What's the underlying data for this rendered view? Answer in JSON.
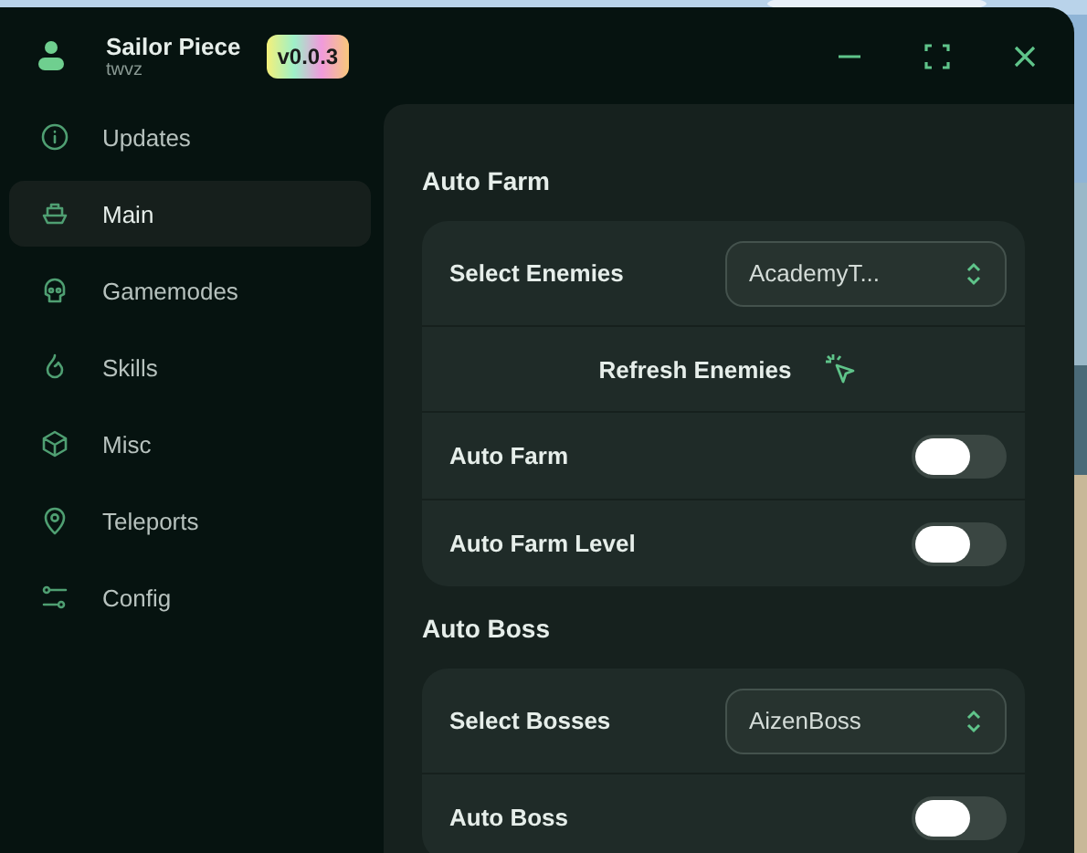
{
  "app": {
    "title": "Sailor Piece",
    "user": "twvz",
    "version": "v0.0.3"
  },
  "sidebar": {
    "items": [
      {
        "label": "Updates",
        "selected": false
      },
      {
        "label": "Main",
        "selected": true
      },
      {
        "label": "Gamemodes",
        "selected": false
      },
      {
        "label": "Skills",
        "selected": false
      },
      {
        "label": "Misc",
        "selected": false
      },
      {
        "label": "Teleports",
        "selected": false
      },
      {
        "label": "Config",
        "selected": false
      }
    ]
  },
  "sections": [
    {
      "title": "Auto Farm",
      "rows": [
        {
          "kind": "dropdown",
          "label": "Select Enemies",
          "value": "AcademyT..."
        },
        {
          "kind": "button",
          "label": "Refresh Enemies"
        },
        {
          "kind": "toggle",
          "label": "Auto Farm",
          "on": false
        },
        {
          "kind": "toggle",
          "label": "Auto Farm Level",
          "on": false
        }
      ]
    },
    {
      "title": "Auto Boss",
      "rows": [
        {
          "kind": "dropdown",
          "label": "Select Bosses",
          "value": "AizenBoss"
        },
        {
          "kind": "toggle",
          "label": "Auto Boss",
          "on": false
        }
      ]
    }
  ]
}
